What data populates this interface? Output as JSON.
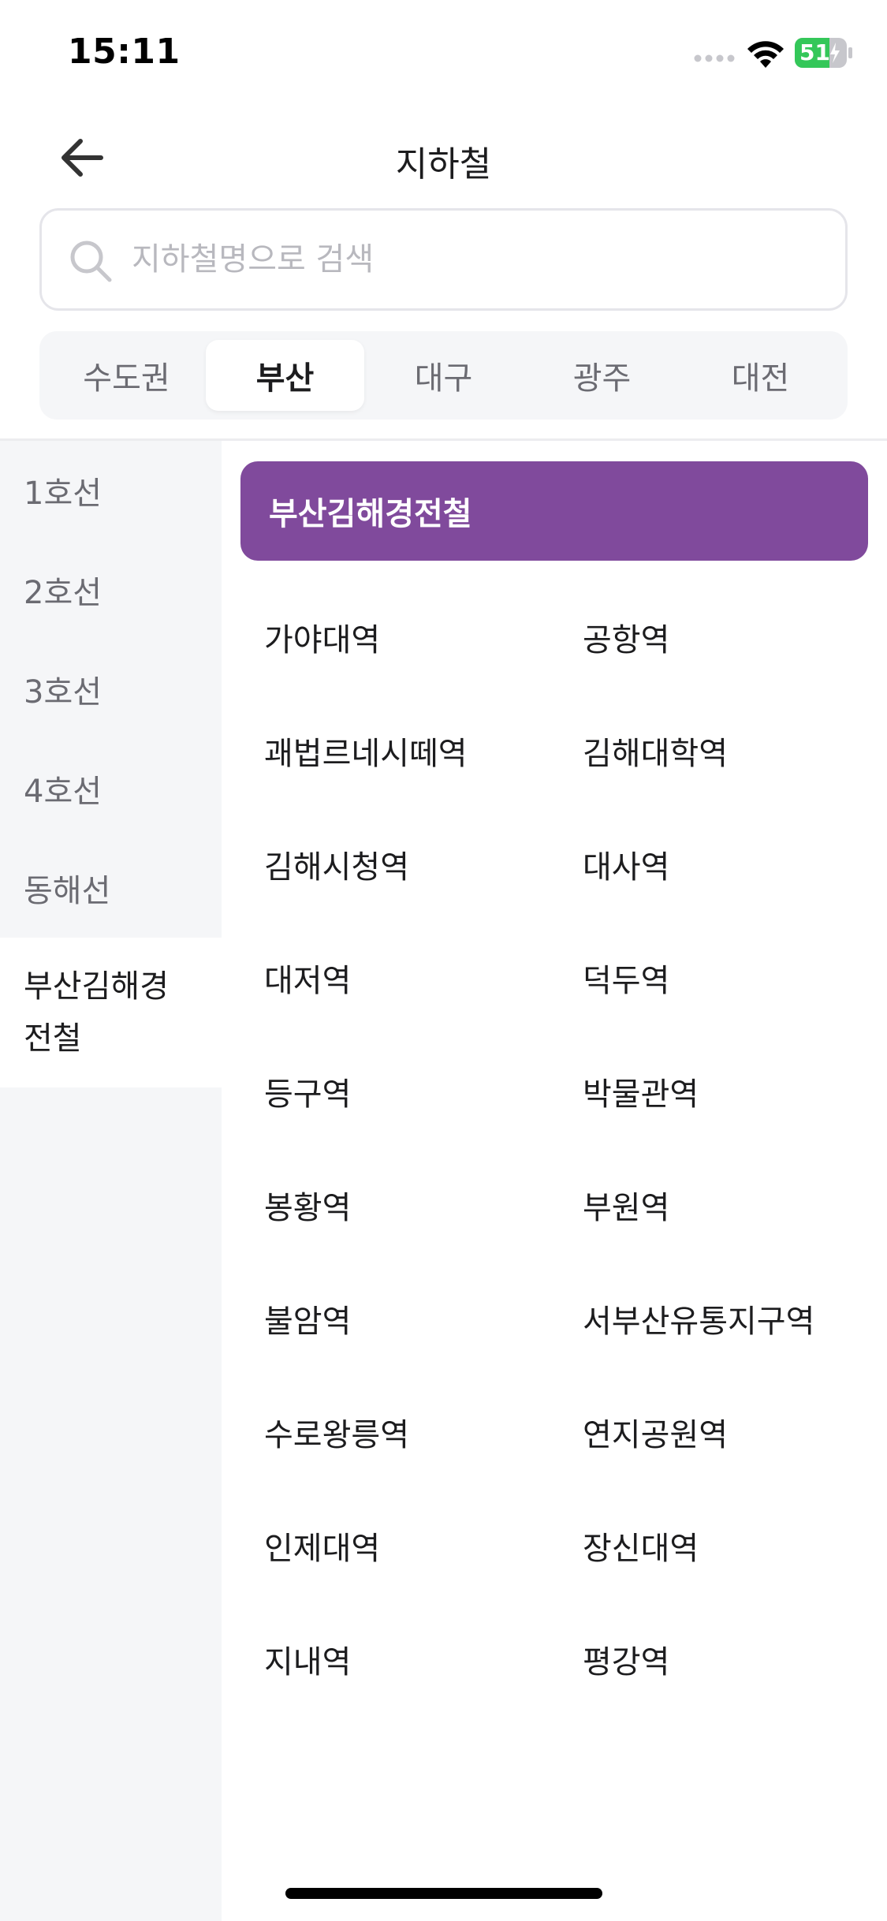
{
  "status_bar": {
    "time": "15:11",
    "battery_level": "51"
  },
  "header": {
    "title": "지하철"
  },
  "search": {
    "placeholder": "지하철명으로 검색",
    "value": ""
  },
  "region_tabs": [
    {
      "label": "수도권",
      "active": false
    },
    {
      "label": "부산",
      "active": true
    },
    {
      "label": "대구",
      "active": false
    },
    {
      "label": "광주",
      "active": false
    },
    {
      "label": "대전",
      "active": false
    }
  ],
  "lines": [
    {
      "label": "1호선",
      "active": false
    },
    {
      "label": "2호선",
      "active": false
    },
    {
      "label": "3호선",
      "active": false
    },
    {
      "label": "4호선",
      "active": false
    },
    {
      "label": "동해선",
      "active": false
    },
    {
      "label": "부산김해경전철",
      "active": true
    }
  ],
  "selected_line": {
    "name": "부산김해경전철",
    "color": "#804a9c"
  },
  "stations": [
    "가야대역",
    "공항역",
    "괘법르네시떼역",
    "김해대학역",
    "김해시청역",
    "대사역",
    "대저역",
    "덕두역",
    "등구역",
    "박물관역",
    "봉황역",
    "부원역",
    "불암역",
    "서부산유통지구역",
    "수로왕릉역",
    "연지공원역",
    "인제대역",
    "장신대역",
    "지내역",
    "평강역"
  ],
  "colors": {
    "accent": "#804a9c",
    "battery": "#34c759",
    "sidebar_bg": "#f5f6f8"
  }
}
